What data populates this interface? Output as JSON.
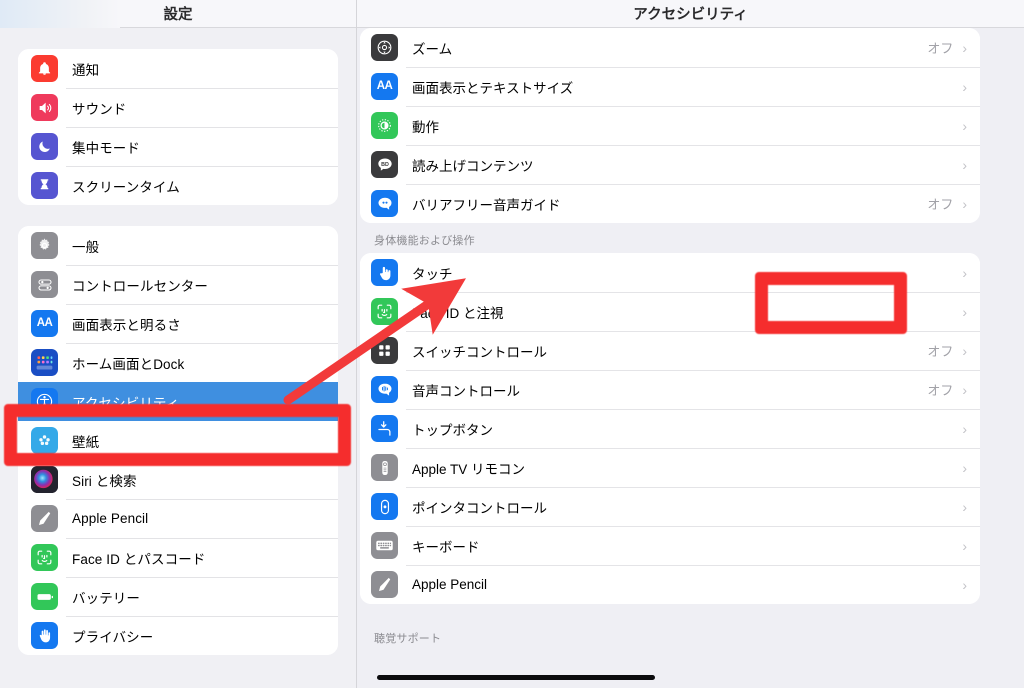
{
  "sidebar": {
    "title": "設定",
    "groups": [
      {
        "partial_top": true,
        "items": []
      },
      {
        "items": [
          {
            "label": "通知",
            "icon": "bell-icon",
            "icon_color": "#fb3b30"
          },
          {
            "label": "サウンド",
            "icon": "speaker-icon",
            "icon_color": "#ef3a5c"
          },
          {
            "label": "集中モード",
            "icon": "moon-icon",
            "icon_color": "#5655d1"
          },
          {
            "label": "スクリーンタイム",
            "icon": "hourglass-icon",
            "icon_color": "#5655d1"
          }
        ]
      },
      {
        "items": [
          {
            "label": "一般",
            "icon": "gear-icon",
            "icon_color": "#8e8e93"
          },
          {
            "label": "コントロールセンター",
            "icon": "control-center-icon",
            "icon_color": "#8e8e93"
          },
          {
            "label": "画面表示と明るさ",
            "icon": "display-brightness-icon",
            "icon_color": "#1478f0"
          },
          {
            "label": "ホーム画面とDock",
            "icon": "home-screen-dock-icon",
            "icon_color": "#1a4ec4"
          },
          {
            "label": "アクセシビリティ",
            "icon": "accessibility-icon",
            "icon_color": "#1478f0",
            "selected": true
          },
          {
            "label": "壁紙",
            "icon": "wallpaper-icon",
            "icon_color": "#34a9e8"
          },
          {
            "label": "Siri と検索",
            "icon": "siri-icon",
            "icon_color": "#2a2a38"
          },
          {
            "label": "Apple Pencil",
            "icon": "apple-pencil-icon",
            "icon_color": "#8e8e93"
          },
          {
            "label": "Face ID とパスコード",
            "icon": "face-id-icon",
            "icon_color": "#32c759"
          },
          {
            "label": "バッテリー",
            "icon": "battery-icon",
            "icon_color": "#32c759"
          },
          {
            "label": "プライバシー",
            "icon": "privacy-hand-icon",
            "icon_color": "#1478f0"
          }
        ]
      }
    ]
  },
  "detail": {
    "title": "アクセシビリティ",
    "groups": [
      {
        "partial_top": true,
        "items": [
          {
            "label": "ズーム",
            "icon": "zoom-icon",
            "icon_color": "#3a3a3c",
            "value": "オフ",
            "chevron": "›"
          },
          {
            "label": "画面表示とテキストサイズ",
            "icon": "display-text-size-icon",
            "icon_color": "#1478f0",
            "value": "",
            "chevron": "›"
          },
          {
            "label": "動作",
            "icon": "motion-icon",
            "icon_color": "#32c759",
            "value": "",
            "chevron": "›"
          },
          {
            "label": "読み上げコンテンツ",
            "icon": "spoken-content-icon",
            "icon_color": "#3a3a3c",
            "value": "",
            "chevron": "›"
          },
          {
            "label": "バリアフリー音声ガイド",
            "icon": "audio-descriptions-icon",
            "icon_color": "#1478f0",
            "value": "オフ",
            "chevron": "›"
          }
        ]
      },
      {
        "section_header": "身体機能および操作",
        "items": [
          {
            "label": "タッチ",
            "icon": "touch-icon",
            "icon_color": "#1478f0",
            "value": "",
            "chevron": "›",
            "highlighted": true
          },
          {
            "label": "Face ID と注視",
            "icon": "face-id-attention-icon",
            "icon_color": "#32c759",
            "value": "",
            "chevron": "›"
          },
          {
            "label": "スイッチコントロール",
            "icon": "switch-control-icon",
            "icon_color": "#3a3a3c",
            "value": "オフ",
            "chevron": "›"
          },
          {
            "label": "音声コントロール",
            "icon": "voice-control-icon",
            "icon_color": "#1478f0",
            "value": "オフ",
            "chevron": "›"
          },
          {
            "label": "トップボタン",
            "icon": "top-button-icon",
            "icon_color": "#1478f0",
            "value": "",
            "chevron": "›"
          },
          {
            "label": "Apple TV リモコン",
            "icon": "apple-tv-remote-icon",
            "icon_color": "#8e8e93",
            "value": "",
            "chevron": "›"
          },
          {
            "label": "ポインタコントロール",
            "icon": "pointer-control-icon",
            "icon_color": "#1478f0",
            "value": "",
            "chevron": "›"
          },
          {
            "label": "キーボード",
            "icon": "keyboard-icon",
            "icon_color": "#8e8e93",
            "value": "",
            "chevron": "›"
          },
          {
            "label": "Apple Pencil",
            "icon": "apple-pencil-icon",
            "icon_color": "#8e8e93",
            "value": "",
            "chevron": "›"
          }
        ]
      },
      {
        "section_header": "聴覚サポート",
        "items": []
      }
    ]
  },
  "annotations": {
    "color": "#f52d2d",
    "sidebar_highlight_target": "アクセシビリティ",
    "detail_highlight_target": "タッチ",
    "arrow": "arrow-pointing-from-accessibility-to-touch"
  }
}
